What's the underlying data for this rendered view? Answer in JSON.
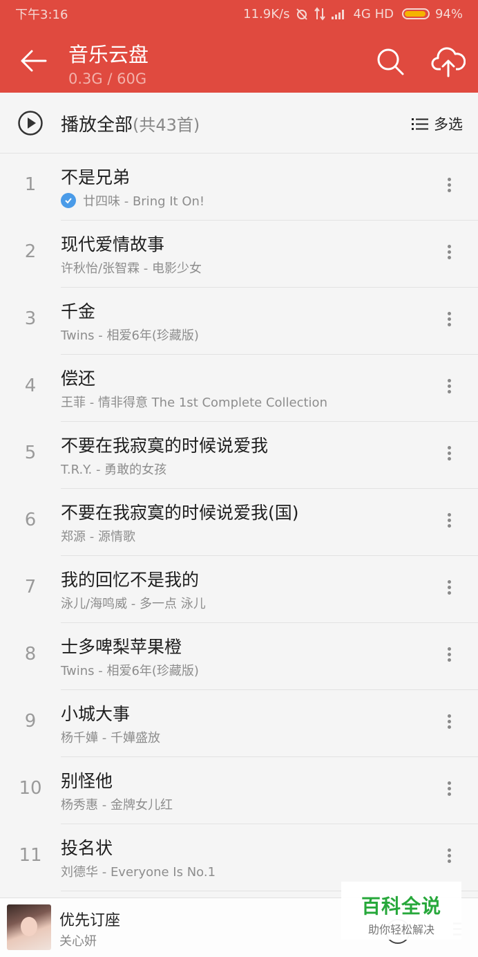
{
  "status_bar": {
    "time": "下午3:16",
    "indicators": "11.9K/s",
    "network": "4G HD",
    "battery": "94%"
  },
  "header": {
    "title": "音乐云盘",
    "storage": "0.3G / 60G",
    "icons": [
      "back-arrow-icon",
      "search-icon",
      "cloud-upload-icon"
    ]
  },
  "play_all": {
    "label": "播放全部",
    "count": "(共43首)",
    "multi_select": "多选"
  },
  "songs": [
    {
      "index": "1",
      "title": "不是兄弟",
      "meta": "廿四味 - Bring It On!",
      "verified": true
    },
    {
      "index": "2",
      "title": "现代爱情故事",
      "meta": "许秋怡/张智霖 - 电影少女"
    },
    {
      "index": "3",
      "title": "千金",
      "meta": "Twins - 相爱6年(珍藏版)"
    },
    {
      "index": "4",
      "title": "偿还",
      "meta": "王菲 - 情非得意 The 1st Complete Collection"
    },
    {
      "index": "5",
      "title": "不要在我寂寞的时候说爱我",
      "meta": "T.R.Y. - 勇敢的女孩"
    },
    {
      "index": "6",
      "title": "不要在我寂寞的时候说爱我(国)",
      "meta": "郑源 - 源情歌"
    },
    {
      "index": "7",
      "title": "我的回忆不是我的",
      "meta": "泳儿/海鸣威 - 多一点 泳儿"
    },
    {
      "index": "8",
      "title": "士多啤梨苹果橙",
      "meta": "Twins - 相爱6年(珍藏版)"
    },
    {
      "index": "9",
      "title": "小城大事",
      "meta": "杨千嬅 - 千嬅盛放"
    },
    {
      "index": "10",
      "title": "别怪他",
      "meta": "杨秀惠 - 金牌女儿红"
    },
    {
      "index": "11",
      "title": "投名状",
      "meta": "刘德华 - Everyone Is No.1"
    }
  ],
  "now_playing": {
    "title": "优先订座",
    "artist": "关心妍"
  },
  "watermark": {
    "title": "百科全说",
    "subtitle": "助你轻松解决"
  },
  "colors": {
    "accent": "#e04a3f",
    "verified": "#4a9be8",
    "watermark": "#27a83b"
  }
}
